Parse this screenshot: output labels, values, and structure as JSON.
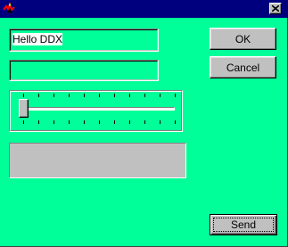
{
  "window": {
    "icon": "red-black-app-icon",
    "close_icon": "close-x-icon",
    "accent": "#00ff99",
    "titlebar_color": "#00007f"
  },
  "edits": {
    "text_value": "Hello DDX",
    "second_value": ""
  },
  "buttons": {
    "ok_label": "OK",
    "cancel_label": "Cancel",
    "send_label": "Send"
  },
  "slider": {
    "position": 0,
    "tick_count": 11
  },
  "progress": {
    "value": 0
  }
}
